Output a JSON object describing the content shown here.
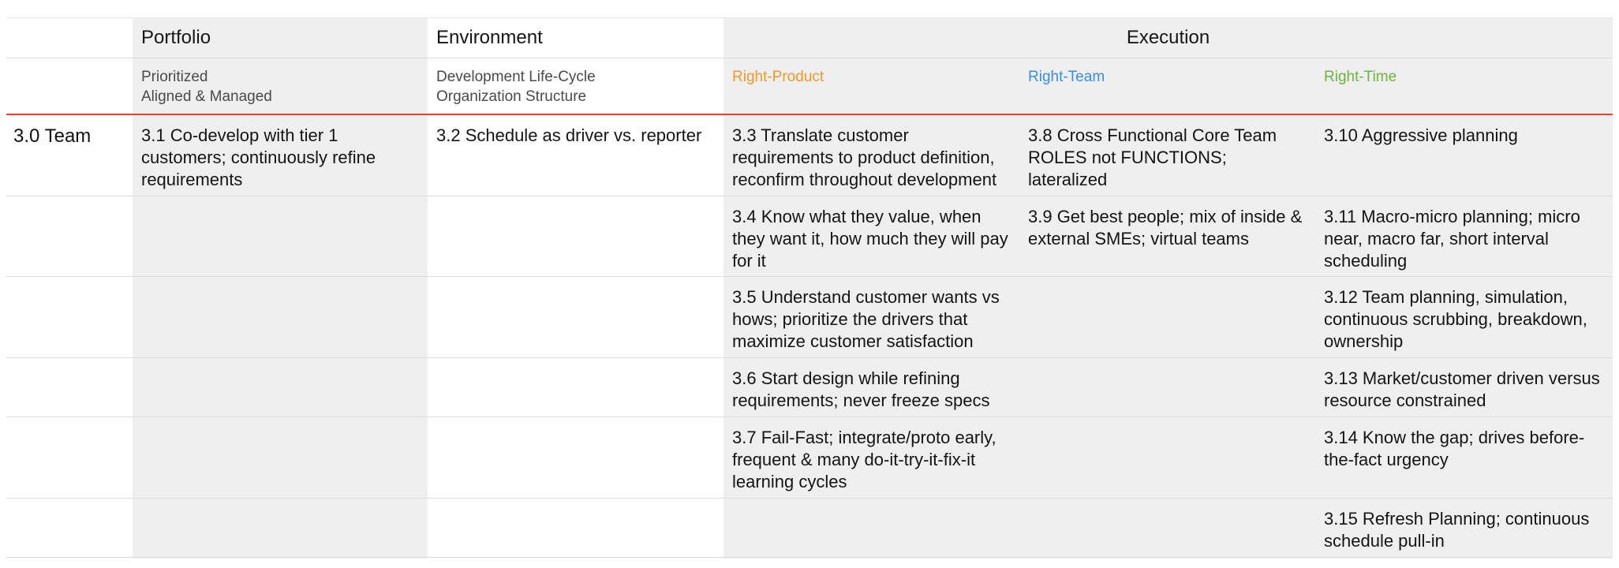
{
  "groups": {
    "portfolio": "Portfolio",
    "environment": "Environment",
    "execution": "Execution"
  },
  "subheaders": {
    "portfolio": [
      "Prioritized",
      "Aligned & Managed"
    ],
    "environment": [
      "Development Life-Cycle",
      "Organization Structure"
    ],
    "right_product": "Right-Product",
    "right_team": "Right-Team",
    "right_time": "Right-Time"
  },
  "colors": {
    "right_product": "#f0972d",
    "right_team": "#3a8ee6",
    "right_time": "#6cb43f",
    "header_rule": "#e8462e",
    "shaded_column": "#efefef"
  },
  "row_label": "3.0 Team",
  "rows": [
    {
      "portfolio": "3.1 Co-develop with tier 1 customers; continuously refine requirements",
      "environment": "3.2 Schedule as driver vs. reporter",
      "right_product": "3.3 Translate customer requirements to product definition, reconfirm throughout development",
      "right_team": "3.8 Cross Functional Core Team ROLES not FUNCTIONS; lateralized",
      "right_time": "3.10 Aggressive planning"
    },
    {
      "portfolio": "",
      "environment": "",
      "right_product": "3.4 Know what they value, when they want it, how much they will pay for it",
      "right_team": "3.9 Get best people; mix of inside & external SMEs; virtual teams",
      "right_time": "3.11 Macro-micro planning; micro near, macro far, short interval scheduling"
    },
    {
      "portfolio": "",
      "environment": "",
      "right_product": "3.5 Understand customer wants vs hows; prioritize the drivers that maximize customer satisfaction",
      "right_team": "",
      "right_time": "3.12 Team planning, simulation, continuous scrubbing, breakdown, ownership"
    },
    {
      "portfolio": "",
      "environment": "",
      "right_product": "3.6 Start design while refining requirements; never freeze specs",
      "right_team": "",
      "right_time": "3.13 Market/customer driven versus resource constrained"
    },
    {
      "portfolio": "",
      "environment": "",
      "right_product": "3.7 Fail-Fast; integrate/proto early, frequent & many do-it-try-it-fix-it learning cycles",
      "right_team": "",
      "right_time": "3.14 Know the gap; drives before-the-fact urgency"
    },
    {
      "portfolio": "",
      "environment": "",
      "right_product": "",
      "right_team": "",
      "right_time": "3.15 Refresh Planning; continuous schedule pull-in"
    }
  ]
}
